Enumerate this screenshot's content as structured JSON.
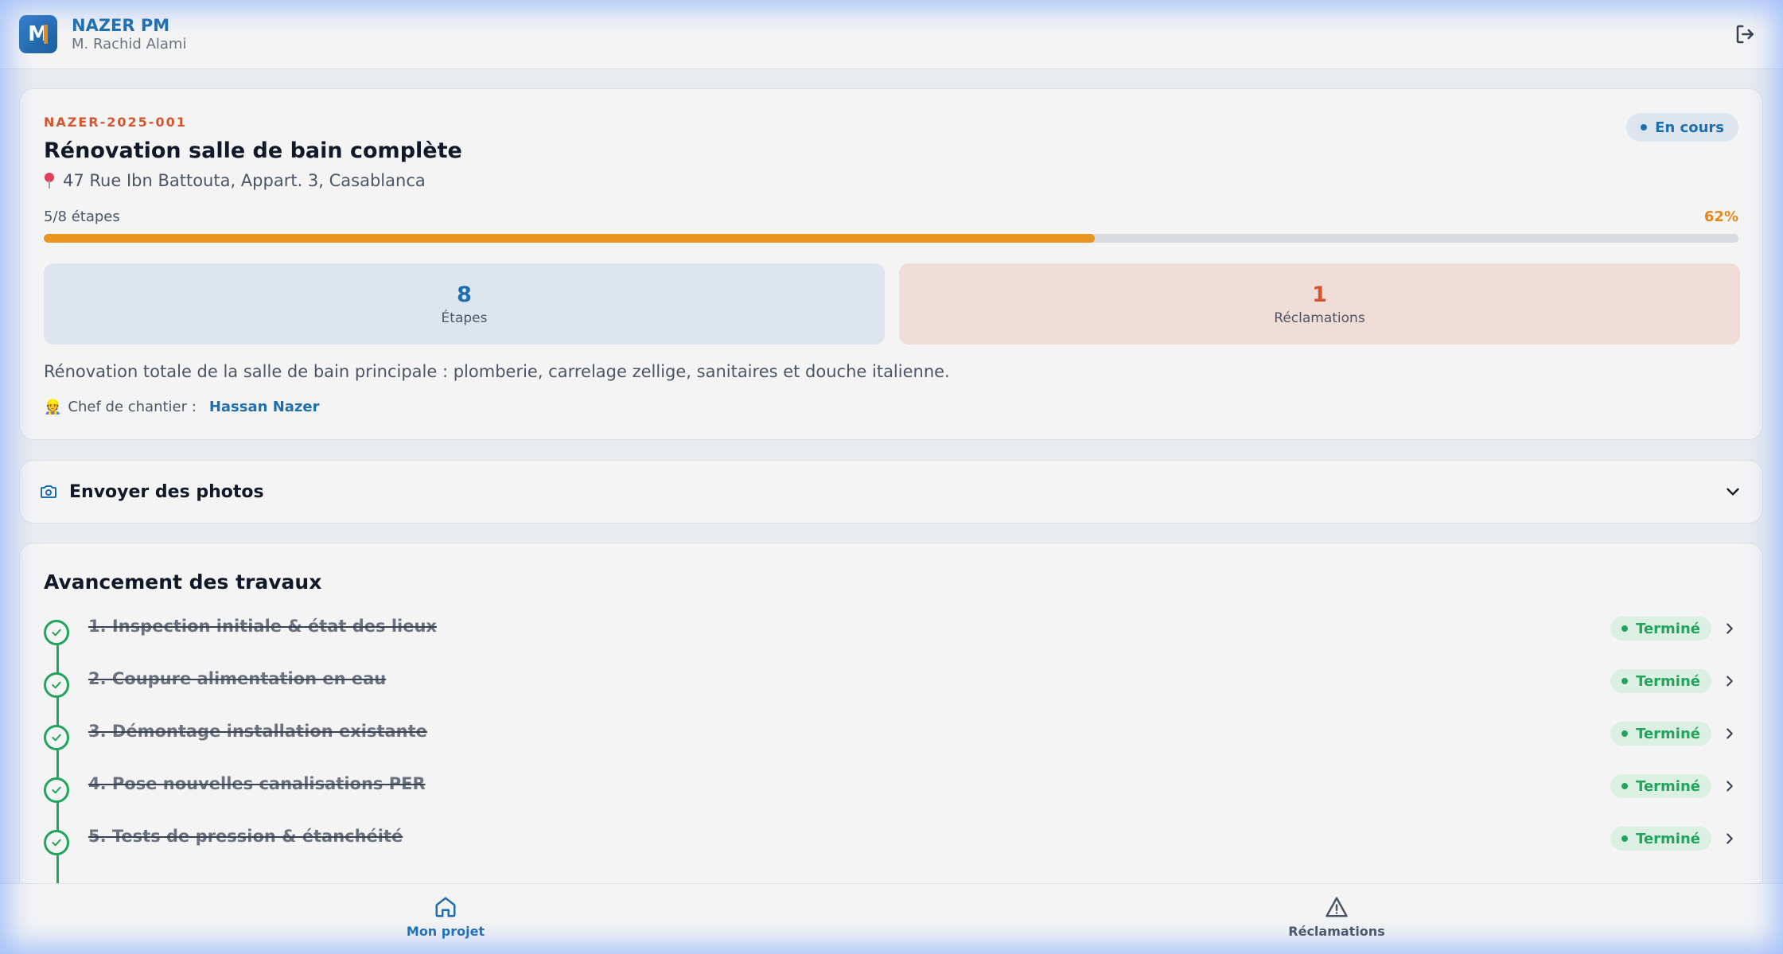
{
  "header": {
    "logo_letter": "M",
    "brand_name": "NAZER PM",
    "user_name": "M. Rachid Alami"
  },
  "project": {
    "code": "NAZER-2025-001",
    "status": "En cours",
    "title": "Rénovation salle de bain complète",
    "address": "47 Rue Ibn Battouta, Appart. 3, Casablanca",
    "steps_progress": "5/8 étapes",
    "percent": "62%",
    "progress_fraction": 0.62,
    "stats": {
      "steps_value": "8",
      "steps_label": "Étapes",
      "claims_value": "1",
      "claims_label": "Réclamations"
    },
    "description": "Rénovation totale de la salle de bain principale : plomberie, carrelage zellige, sanitaires et douche italienne.",
    "chef_label": "Chef de chantier :",
    "chef_name": "Hassan Nazer"
  },
  "photos": {
    "label": "Envoyer des photos"
  },
  "works": {
    "title": "Avancement des travaux",
    "steps": [
      {
        "label": "1. Inspection initiale & état des lieux",
        "status": "Terminé"
      },
      {
        "label": "2. Coupure alimentation en eau",
        "status": "Terminé"
      },
      {
        "label": "3. Démontage installation existante",
        "status": "Terminé"
      },
      {
        "label": "4. Pose nouvelles canalisations PER",
        "status": "Terminé"
      },
      {
        "label": "5. Tests de pression & étanchéité",
        "status": "Terminé"
      }
    ]
  },
  "nav": {
    "home_label": "Mon projet",
    "claims_label": "Réclamations"
  },
  "colors": {
    "brand": "#1f6fad",
    "accent": "#e9951f",
    "danger": "#d4552e",
    "success": "#22a45d"
  }
}
